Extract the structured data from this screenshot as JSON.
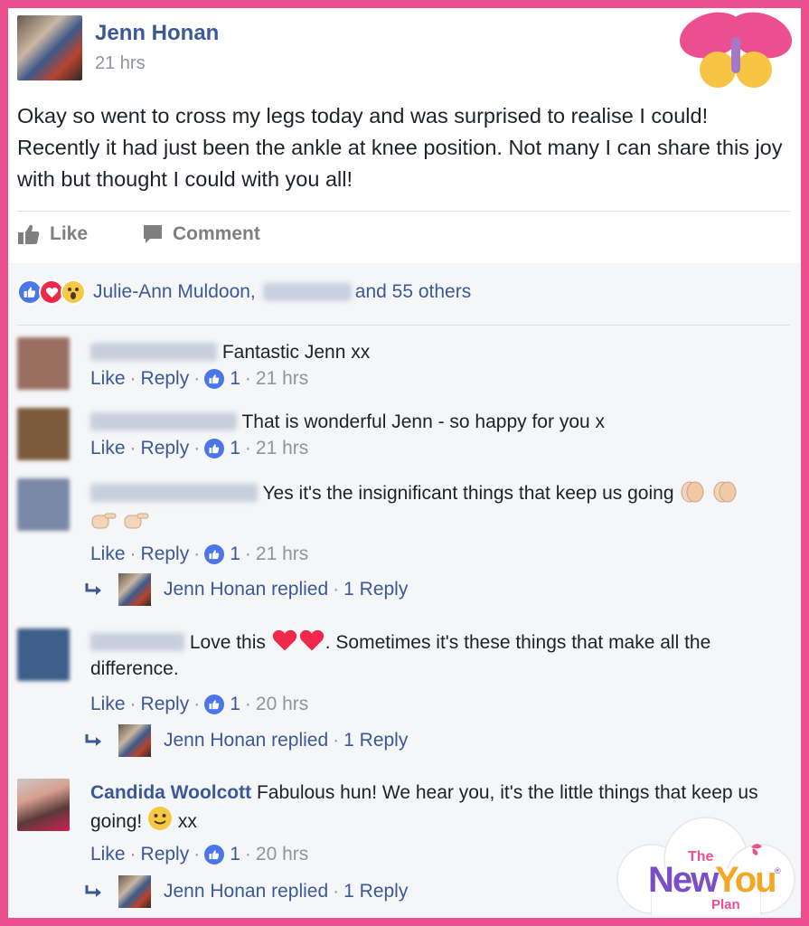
{
  "post": {
    "author": "Jenn Honan",
    "time": "21 hrs",
    "text": "Okay so went to cross my legs today and was surprised to realise I could! Recently it had just been the ankle at knee position. Not many I can share this joy with but thought I could with you all!",
    "actions": {
      "like": "Like",
      "comment": "Comment"
    },
    "reactions": {
      "first_name": "Julie-Ann Muldoon,",
      "others": "and 55 others"
    }
  },
  "comments": [
    {
      "text": "Fantastic Jenn xx",
      "like": "Like",
      "reply": "Reply",
      "count": "1",
      "time": "21 hrs"
    },
    {
      "text": "That is wonderful Jenn - so happy for you x",
      "like": "Like",
      "reply": "Reply",
      "count": "1",
      "time": "21 hrs"
    },
    {
      "text": "Yes it's the insignificant things that keep us going",
      "like": "Like",
      "reply": "Reply",
      "count": "1",
      "time": "21 hrs",
      "replied": "Jenn Honan replied",
      "replies": "1 Reply"
    },
    {
      "text_a": "Love this",
      "text_b": ". Sometimes it's these things that make all the difference.",
      "like": "Like",
      "reply": "Reply",
      "count": "1",
      "time": "20 hrs",
      "replied": "Jenn Honan replied",
      "replies": "1 Reply"
    },
    {
      "name": "Candida Woolcott",
      "text_a": "Fabulous hun! We hear you, it's the little things that keep us going!",
      "text_b": "xx",
      "like": "Like",
      "reply": "Reply",
      "count": "1",
      "time": "20 hrs",
      "replied": "Jenn Honan replied",
      "replies": "1 Reply"
    }
  ],
  "separator": "·",
  "logo": {
    "the": "The",
    "new": "New",
    "you": "You",
    "plan": "Plan",
    "reg": "®"
  },
  "colors": {
    "frame": "#ec4f8f",
    "link": "#3b5998",
    "like_blue": "#4a76e8",
    "love_red": "#f0284a"
  }
}
